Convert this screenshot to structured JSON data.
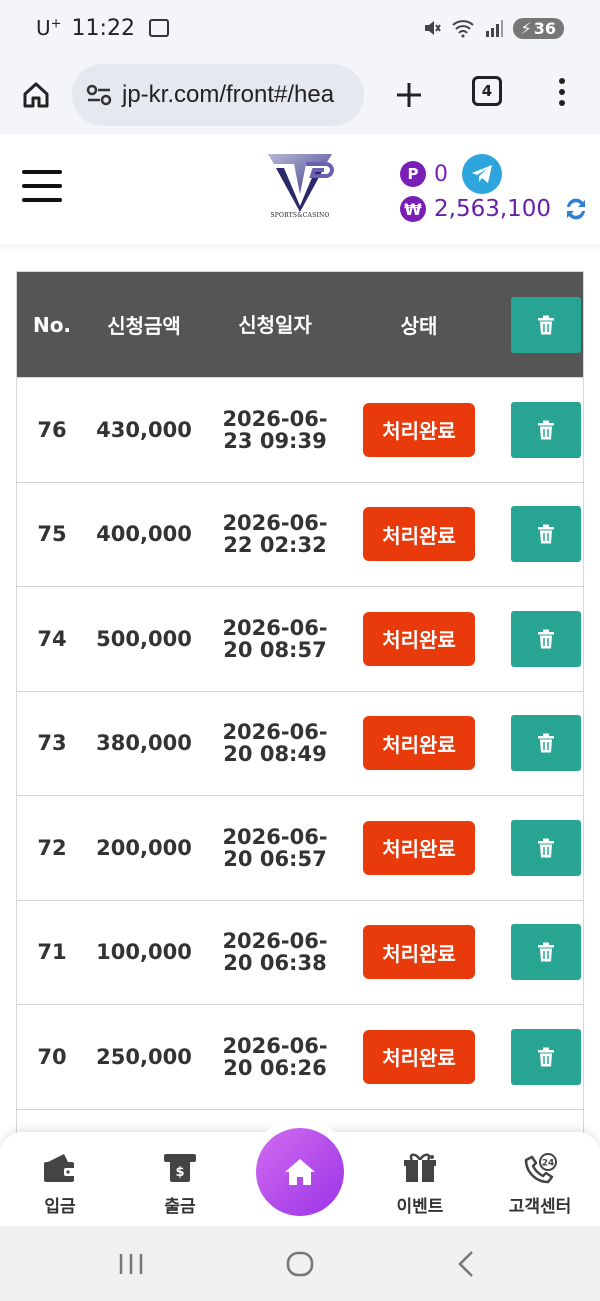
{
  "status_bar": {
    "carrier": "U",
    "carrier_sup": "+",
    "time": "11:22",
    "battery": "36"
  },
  "browser": {
    "url": "jp-kr.com/front#/hea",
    "tab_count": "4"
  },
  "header": {
    "logo_text": "SPORTS&CASINO",
    "points_badge": "P",
    "points": "0",
    "currency_badge": "₩",
    "balance": "2,563,100"
  },
  "table": {
    "columns": [
      "No.",
      "신청금액",
      "신청일자",
      "상태"
    ],
    "rows": [
      {
        "no": "76",
        "amount": "430,000",
        "date": "2026-06-",
        "time": "23 09:39",
        "status": "처리완료"
      },
      {
        "no": "75",
        "amount": "400,000",
        "date": "2026-06-",
        "time": "22 02:32",
        "status": "처리완료"
      },
      {
        "no": "74",
        "amount": "500,000",
        "date": "2026-06-",
        "time": "20 08:57",
        "status": "처리완료"
      },
      {
        "no": "73",
        "amount": "380,000",
        "date": "2026-06-",
        "time": "20 08:49",
        "status": "처리완료"
      },
      {
        "no": "72",
        "amount": "200,000",
        "date": "2026-06-",
        "time": "20 06:57",
        "status": "처리완료"
      },
      {
        "no": "71",
        "amount": "100,000",
        "date": "2026-06-",
        "time": "20 06:38",
        "status": "처리완료"
      },
      {
        "no": "70",
        "amount": "250,000",
        "date": "2026-06-",
        "time": "20 06:26",
        "status": "처리완료"
      }
    ]
  },
  "bottom_nav": {
    "deposit": "입금",
    "withdraw": "출금",
    "event": "이벤트",
    "support": "고객센터",
    "support_badge": "24"
  },
  "colors": {
    "accent_purple": "#7a1fb5",
    "status_red": "#e93a0b",
    "teal": "#27a592",
    "header_gray": "#555555"
  }
}
